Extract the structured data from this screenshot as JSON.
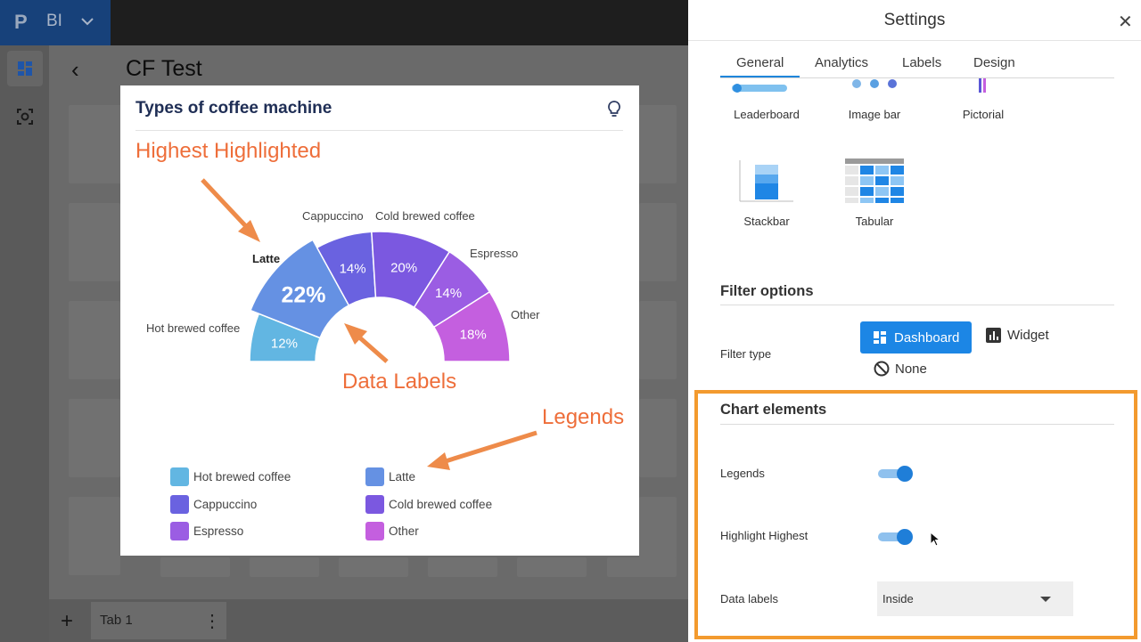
{
  "topbar": {
    "brand_logo": "P",
    "brand_name": "BI"
  },
  "dashboard": {
    "back": "‹",
    "title": "CF Test",
    "tab_label": "Tab 1",
    "add": "+",
    "more": "⋮"
  },
  "widget": {
    "title": "Types of coffee machine",
    "annotations": {
      "highest": "Highest Highlighted",
      "data_labels": "Data Labels",
      "legends": "Legends"
    },
    "category_labels": {
      "hot": "Hot brewed coffee",
      "latte": "Latte",
      "cappuccino": "Cappuccino",
      "cold": "Cold brewed coffee",
      "espresso": "Espresso",
      "other": "Other"
    },
    "data_labels": {
      "hot": "12%",
      "latte": "22%",
      "cappuccino": "14%",
      "cold": "20%",
      "espresso": "14%",
      "other": "18%"
    },
    "legend": {
      "hot": "Hot brewed coffee",
      "latte": "Latte",
      "cappuccino": "Cappuccino",
      "cold": "Cold brewed coffee",
      "espresso": "Espresso",
      "other": "Other"
    }
  },
  "chart_data": {
    "type": "pie",
    "variant": "half-donut",
    "title": "Types of coffee machine",
    "categories": [
      "Hot brewed coffee",
      "Latte",
      "Cappuccino",
      "Cold brewed coffee",
      "Espresso",
      "Other"
    ],
    "values": [
      12,
      22,
      14,
      20,
      14,
      18
    ],
    "unit": "%",
    "highlighted": "Latte",
    "colors": [
      "#62b6e2",
      "#6591e3",
      "#6a62e0",
      "#7b58e0",
      "#9b5de3",
      "#c45fdf"
    ],
    "legend": "bottom"
  },
  "settings": {
    "title": "Settings",
    "close": "✕",
    "tabs": {
      "general": "General",
      "analytics": "Analytics",
      "labels": "Labels",
      "design": "Design"
    },
    "chart_types": {
      "leaderboard": "Leaderboard",
      "image_bar": "Image bar",
      "pictorial": "Pictorial",
      "stackbar": "Stackbar",
      "tabular": "Tabular"
    },
    "filter": {
      "section": "Filter options",
      "type_label": "Filter type",
      "dashboard": "Dashboard",
      "widget": "Widget",
      "none": "None"
    },
    "chart_elements": {
      "section": "Chart elements",
      "legends_label": "Legends",
      "legends_on": true,
      "highlight_label": "Highlight Highest",
      "highlight_on": true,
      "data_labels_label": "Data labels",
      "data_labels_value": "Inside"
    }
  },
  "colors": {
    "accent": "#1c86e5",
    "annotation": "#ee6e3a",
    "highlight_box": "#f39a2e"
  }
}
